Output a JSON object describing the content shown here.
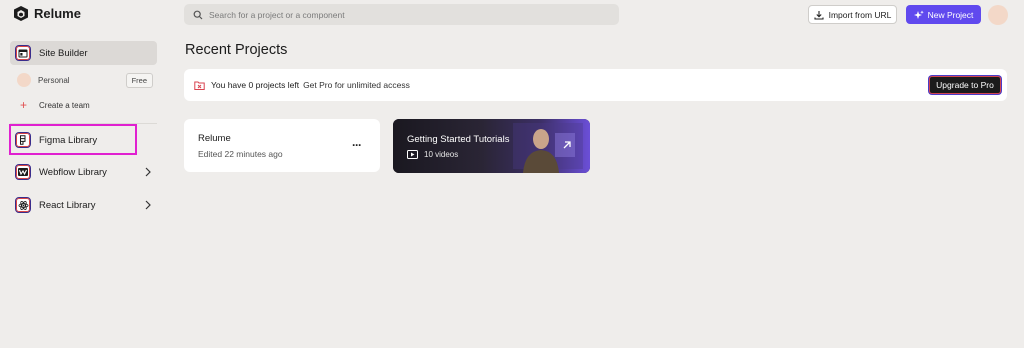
{
  "app": {
    "name": "Relume"
  },
  "search": {
    "placeholder": "Search for a project or a component"
  },
  "header": {
    "import_label": "Import from URL",
    "new_project_label": "New Project"
  },
  "sidebar": {
    "site_builder": "Site Builder",
    "personal": "Personal",
    "free_badge": "Free",
    "create_team": "Create a team",
    "figma_library": "Figma Library",
    "webflow_library": "Webflow Library",
    "react_library": "React Library"
  },
  "main": {
    "title": "Recent Projects",
    "banner": {
      "strong": "You have 0 projects left",
      "sub": "Get Pro for unlimited access",
      "upgrade_label": "Upgrade to Pro"
    },
    "project": {
      "name": "Relume",
      "meta": "Edited 22 minutes ago",
      "more": "···"
    },
    "tutorials": {
      "title": "Getting Started Tutorials",
      "count": "10 videos"
    }
  },
  "colors": {
    "accent": "#6049ee",
    "highlight": "#e020d0",
    "background": "#efedeb"
  },
  "icons": [
    "relume-logo-icon",
    "search-icon",
    "download-icon",
    "sparkle-icon",
    "site-builder-icon",
    "figma-icon",
    "webflow-icon",
    "react-icon",
    "chevron-right-icon",
    "folder-alert-icon",
    "play-icon",
    "external-arrow-icon"
  ]
}
